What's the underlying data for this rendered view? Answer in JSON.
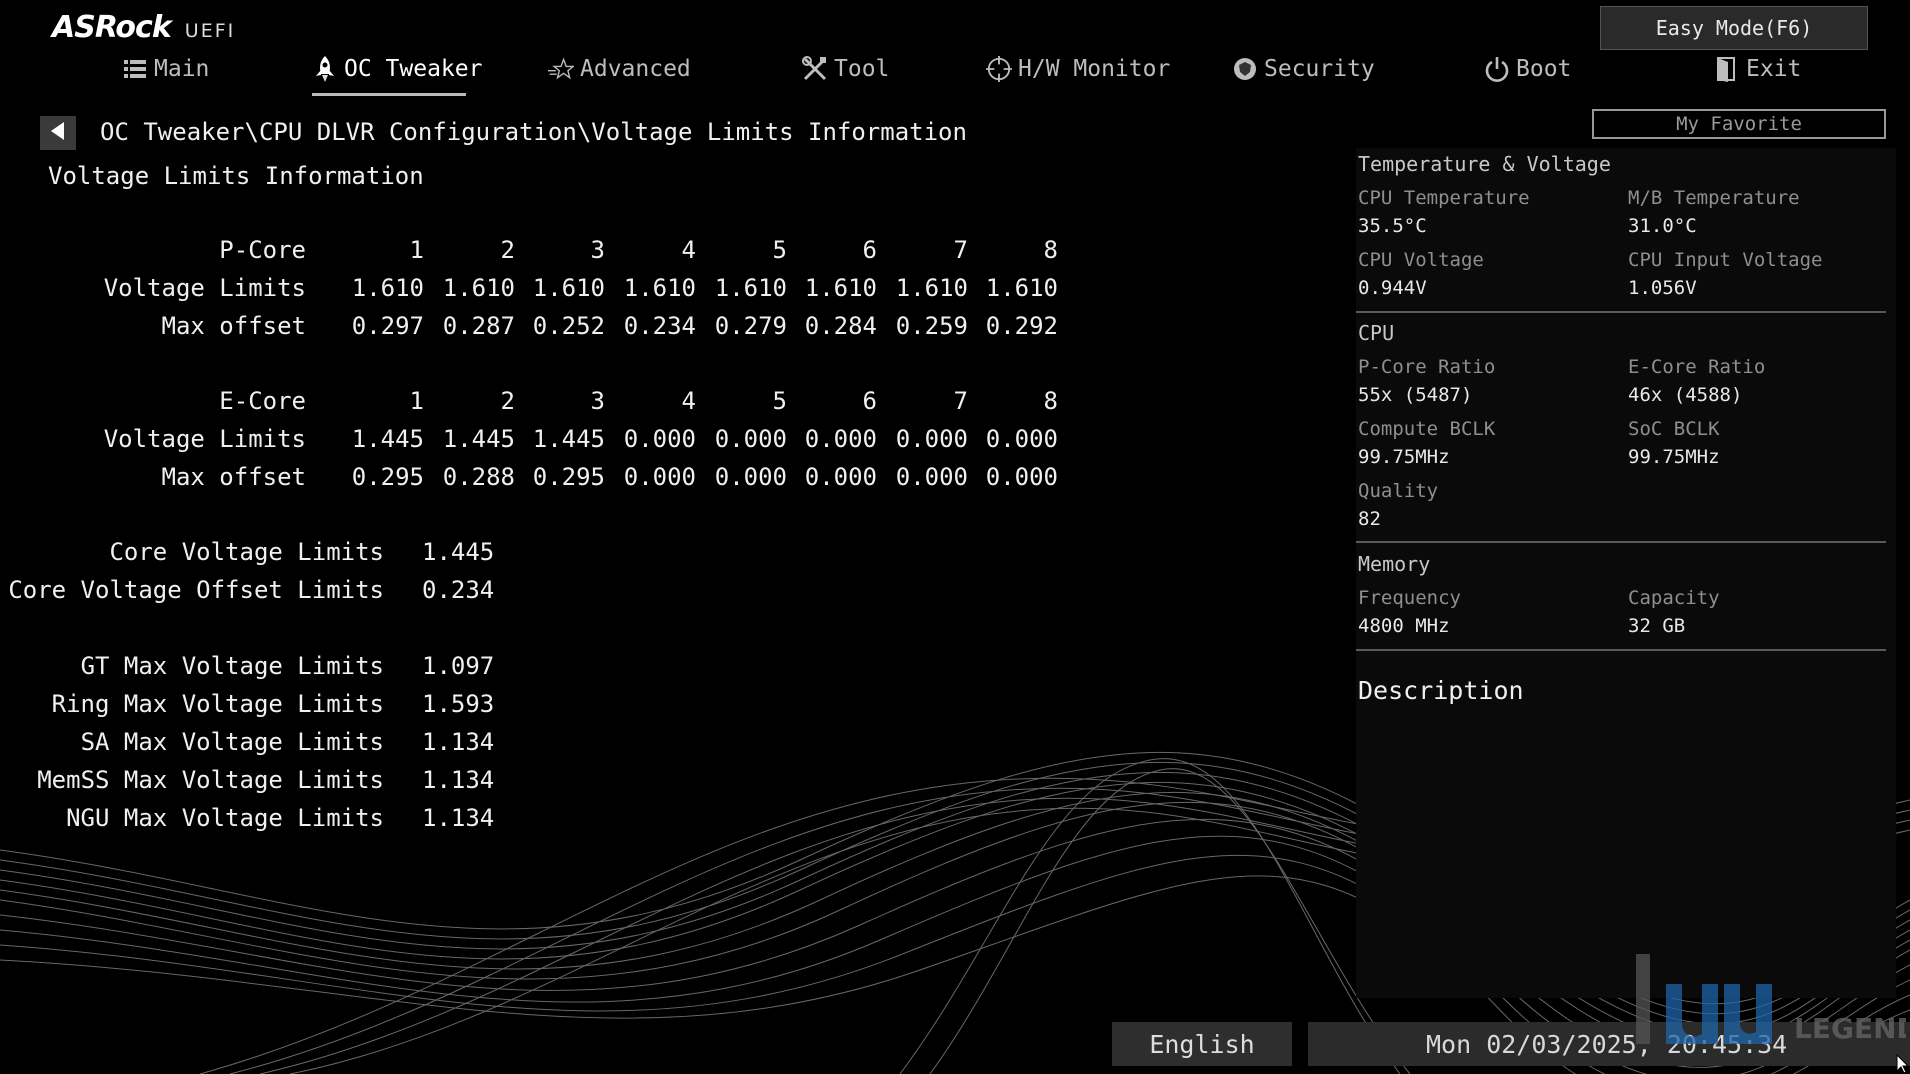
{
  "header": {
    "brand": "ASRock",
    "product": "UEFI",
    "easy_mode_label": "Easy Mode(F6)"
  },
  "tabs": [
    {
      "label": "Main",
      "icon": "list-icon"
    },
    {
      "label": "OC Tweaker",
      "icon": "rocket-icon",
      "active": true
    },
    {
      "label": "Advanced",
      "icon": "star-icon"
    },
    {
      "label": "Tool",
      "icon": "tools-icon"
    },
    {
      "label": "H/W Monitor",
      "icon": "crosshair-icon"
    },
    {
      "label": "Security",
      "icon": "shield-icon"
    },
    {
      "label": "Boot",
      "icon": "power-icon"
    },
    {
      "label": "Exit",
      "icon": "exit-icon"
    }
  ],
  "breadcrumb": "OC Tweaker\\CPU DLVR Configuration\\Voltage Limits Information",
  "page_title": "Voltage Limits Information",
  "pcore": {
    "header": "P-Core",
    "cores": [
      "1",
      "2",
      "3",
      "4",
      "5",
      "6",
      "7",
      "8"
    ],
    "rows": [
      {
        "label": "Voltage Limits",
        "values": [
          "1.610",
          "1.610",
          "1.610",
          "1.610",
          "1.610",
          "1.610",
          "1.610",
          "1.610"
        ]
      },
      {
        "label": "Max offset",
        "values": [
          "0.297",
          "0.287",
          "0.252",
          "0.234",
          "0.279",
          "0.284",
          "0.259",
          "0.292"
        ]
      }
    ]
  },
  "ecore": {
    "header": "E-Core",
    "cores": [
      "1",
      "2",
      "3",
      "4",
      "5",
      "6",
      "7",
      "8"
    ],
    "rows": [
      {
        "label": "Voltage Limits",
        "values": [
          "1.445",
          "1.445",
          "1.445",
          "0.000",
          "0.000",
          "0.000",
          "0.000",
          "0.000"
        ]
      },
      {
        "label": "Max offset",
        "values": [
          "0.295",
          "0.288",
          "0.295",
          "0.000",
          "0.000",
          "0.000",
          "0.000",
          "0.000"
        ]
      }
    ]
  },
  "core_limits": [
    {
      "label": "Core Voltage Limits",
      "value": "1.445"
    },
    {
      "label": "Core Voltage Offset Limits",
      "value": "0.234"
    }
  ],
  "max_limits": [
    {
      "label": "GT Max Voltage Limits",
      "value": "1.097"
    },
    {
      "label": "Ring Max Voltage Limits",
      "value": "1.593"
    },
    {
      "label": "SA Max Voltage Limits",
      "value": "1.134"
    },
    {
      "label": "MemSS Max Voltage Limits",
      "value": "1.134"
    },
    {
      "label": "NGU Max Voltage Limits",
      "value": "1.134"
    }
  ],
  "sidebar": {
    "favorite_label": "My Favorite",
    "temp_voltage": {
      "title": "Temperature & Voltage",
      "items": [
        {
          "label": "CPU Temperature",
          "value": "35.5°C"
        },
        {
          "label": "M/B Temperature",
          "value": "31.0°C"
        },
        {
          "label": "CPU Voltage",
          "value": "0.944V"
        },
        {
          "label": "CPU Input Voltage",
          "value": "1.056V"
        }
      ]
    },
    "cpu": {
      "title": "CPU",
      "items": [
        {
          "label": "P-Core Ratio",
          "value": "55x (5487)"
        },
        {
          "label": "E-Core Ratio",
          "value": "46x (4588)"
        },
        {
          "label": "Compute BCLK",
          "value": "99.75MHz"
        },
        {
          "label": "SoC BCLK",
          "value": "99.75MHz"
        },
        {
          "label": "Quality",
          "value": "82"
        }
      ]
    },
    "memory": {
      "title": "Memory",
      "items": [
        {
          "label": "Frequency",
          "value": "4800 MHz"
        },
        {
          "label": "Capacity",
          "value": "32 GB"
        }
      ]
    },
    "description_title": "Description"
  },
  "footer": {
    "language": "English",
    "datetime": "Mon 02/03/2025, 20:45:34",
    "watermark_text": "LEGEND"
  }
}
